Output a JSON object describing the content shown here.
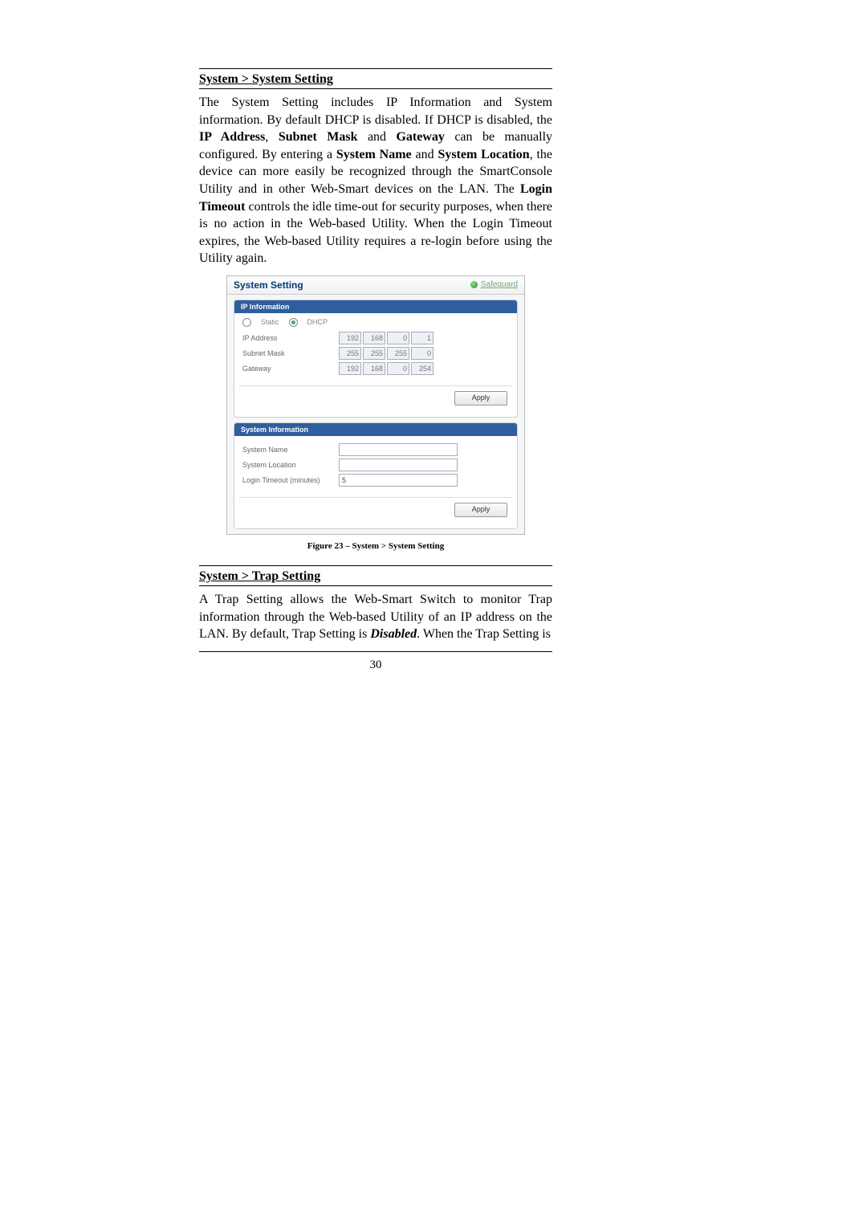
{
  "section1": {
    "heading": "System > System Setting",
    "para_parts": [
      {
        "t": "The System Setting includes IP Information and System information. By default DHCP is disabled. If DHCP is disabled, the "
      },
      {
        "t": "IP Address",
        "b": true
      },
      {
        "t": ", "
      },
      {
        "t": "Subnet Mask",
        "b": true
      },
      {
        "t": " and "
      },
      {
        "t": "Gateway",
        "b": true
      },
      {
        "t": " can be manually configured. By entering a "
      },
      {
        "t": "System Name",
        "b": true
      },
      {
        "t": " and "
      },
      {
        "t": "System Location",
        "b": true
      },
      {
        "t": ", the device can more easily be recognized through the SmartConsole Utility and in other Web-Smart devices on the LAN. The "
      },
      {
        "t": "Login Timeout",
        "b": true
      },
      {
        "t": " controls the idle time-out for security purposes, when there is no action in the Web-based Utility. When the Login Timeout expires, the Web-based Utility requires a re-login before using the Utility again."
      }
    ]
  },
  "screenshot": {
    "title": "System Setting",
    "safeguard": "Safeguard",
    "ip_panel": {
      "header": "IP Information",
      "radio_static": "Static",
      "radio_dhcp": "DHCP",
      "dhcp_selected": true,
      "rows": {
        "ip": {
          "label": "IP Address",
          "octets": [
            "192",
            "168",
            "0",
            "1"
          ]
        },
        "mask": {
          "label": "Subnet Mask",
          "octets": [
            "255",
            "255",
            "255",
            "0"
          ]
        },
        "gateway": {
          "label": "Gateway",
          "octets": [
            "192",
            "168",
            "0",
            "254"
          ]
        }
      },
      "apply": "Apply"
    },
    "sys_panel": {
      "header": "System Information",
      "rows": {
        "name": {
          "label": "System Name",
          "value": ""
        },
        "location": {
          "label": "System Location",
          "value": ""
        },
        "timeout": {
          "label": "Login Timeout (minutes)",
          "value": "5"
        }
      },
      "apply": "Apply"
    }
  },
  "figure_caption": "Figure 23 – System > System Setting",
  "section2": {
    "heading": "System > Trap Setting",
    "para_parts": [
      {
        "t": "A Trap Setting allows the Web-Smart Switch to monitor Trap information through the Web-based Utility of an IP address on the LAN. By default, Trap Setting is "
      },
      {
        "t": "Disabled",
        "b": true,
        "i": true
      },
      {
        "t": ". When the Trap Setting is"
      }
    ]
  },
  "page_number": "30"
}
